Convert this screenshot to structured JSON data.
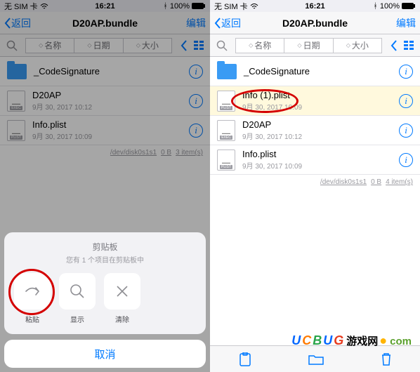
{
  "status": {
    "carrier": "无 SIM 卡",
    "time": "16:21",
    "bt": "100%"
  },
  "nav": {
    "back": "返回",
    "title": "D20AP.bundle",
    "edit": "编辑"
  },
  "sort": {
    "name": "名称",
    "date": "日期",
    "size": "大小"
  },
  "left": {
    "files": [
      {
        "name": "_CodeSignature",
        "date": "",
        "type": "folder"
      },
      {
        "name": "D20AP",
        "date": "9月 30, 2017 10:12",
        "type": "exec"
      },
      {
        "name": "Info.plist",
        "date": "9月 30, 2017 10:09",
        "type": "plist"
      }
    ],
    "footer": {
      "disk": "/dev/disk0s1s1",
      "size": "0 B",
      "count": "3 item(s)"
    }
  },
  "right": {
    "files": [
      {
        "name": "_CodeSignature",
        "date": "",
        "type": "folder"
      },
      {
        "name": "Info (1).plist",
        "date": "9月 30, 2017 10:09",
        "type": "plist",
        "hi": true
      },
      {
        "name": "D20AP",
        "date": "9月 30, 2017 10:12",
        "type": "exec"
      },
      {
        "name": "Info.plist",
        "date": "9月 30, 2017 10:09",
        "type": "plist"
      }
    ],
    "footer": {
      "disk": "/dev/disk0s1s1",
      "size": "0 B",
      "count": "4 item(s)"
    }
  },
  "sheet": {
    "title": "剪贴板",
    "sub": "您有 1 个项目在剪贴板中",
    "paste": "粘贴",
    "show": "显示",
    "clear": "清除",
    "cancel": "取消"
  },
  "watermark": {
    "text": "UCBUG",
    "suffix": "游戏网",
    "dot": "●",
    "com": "com"
  }
}
